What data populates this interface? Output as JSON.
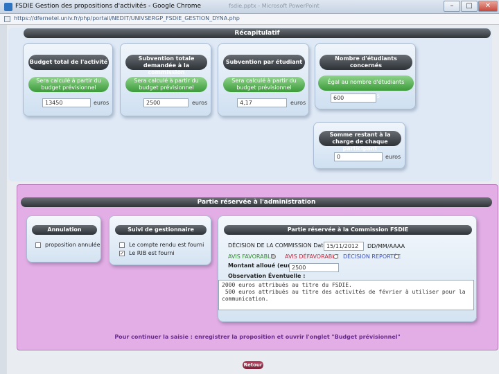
{
  "window": {
    "title": "FSDIE Gestion des propositions d'activités - Google Chrome",
    "background_title": "fsdie.pptx - Microsoft PowerPoint",
    "url": "https://dfernetel.univ.fr/php/portail/NEDIT/UNIVSERGP_FSDIE_GESTION_DYNA.php",
    "minimize": "–",
    "maximize": "□",
    "close": "✕"
  },
  "recap": {
    "header": "Récapitulatif",
    "budget": {
      "title": "Budget total de l'activité",
      "green": "Sera calculé à partir du budget prévisionnel",
      "value": "13450",
      "unit": "euros"
    },
    "subvention_totale": {
      "title": "Subvention totale demandée à la commission",
      "green": "Sera calculé à partir du budget prévisionnel",
      "value": "2500",
      "unit": "euros"
    },
    "subvention_etudiant": {
      "title": "Subvention par étudiant",
      "green": "Sera calculé à partir du budget prévisionnel",
      "value": "4,17",
      "unit": "euros"
    },
    "nombre_etudiants": {
      "title": "Nombre d'étudiants concernés",
      "green": "Égal au nombre d'étudiants présentés",
      "value": "600"
    },
    "somme_restant": {
      "title": "Somme restant à la charge de chaque participant",
      "value": "0",
      "unit": "euros"
    }
  },
  "admin": {
    "header": "Partie réservée à l'administration",
    "annulation": {
      "title": "Annulation",
      "checkbox_label": "proposition annulée"
    },
    "suivi": {
      "title": "Suivi de gestionnaire",
      "item1": "Le compte rendu est fourni",
      "item2": "Le RIB est fourni"
    },
    "commission": {
      "title": "Partie réservée à la Commission FSDIE",
      "decision_label": "DÉCISION DE LA COMMISSION Datée le :",
      "date_value": "15/11/2012",
      "date_format": "DD/MM/AAAA",
      "avis_favorable": "AVIS FAVORABLE",
      "avis_defavorable": "AVIS DÉFAVORABLE",
      "decision_reportee": "DÉCISION REPORTÉE",
      "montant_label": "Montant alloué (euros) :",
      "montant_value": "2500",
      "observation_label": "Observation Éventuelle :",
      "observation_text": "2000 euros attribués au titre du FSDIE.\n 500 euros attribués au titre des activités de février à utiliser pour la communication."
    }
  },
  "footer": {
    "continue_text": "Pour continuer la saisie : enregistrer la proposition et ouvrir l'onglet \"Budget prévisionnel\"",
    "retour": "Retour"
  },
  "colors": {
    "admin_bg": "#e2aee5",
    "recap_bg": "#dfe9f6",
    "pill_dark": "#3a3f44",
    "pill_green": "#4fae4b",
    "avis_favorable": "#2e8b2e",
    "avis_defavorable": "#c0283c",
    "decision_reportee": "#3a4fc0"
  }
}
